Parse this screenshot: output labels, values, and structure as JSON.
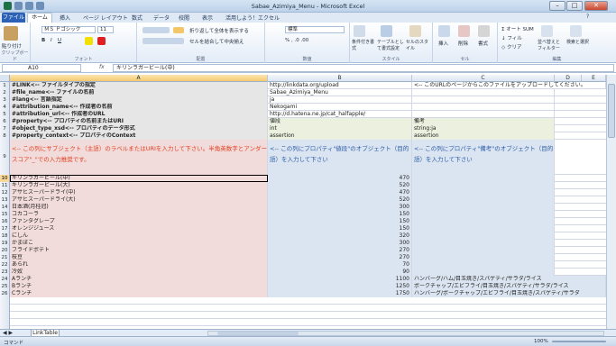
{
  "window": {
    "title": "Sabae_Azimiya_Menu - Microsoft Excel"
  },
  "ribbon_tabs": {
    "file": "ファイル",
    "home": "ホーム",
    "insert": "挿入",
    "page_layout": "ページ レイアウト",
    "formulas": "数式",
    "data": "データ",
    "review": "校閲",
    "view": "表示",
    "addins": "活用しよう！エクセル"
  },
  "ribbon": {
    "paste": "貼り付け",
    "clipboard": "クリップボード",
    "font_name": "ＭＳ Ｐゴシック",
    "font_size": "11",
    "font": "フォント",
    "wrap": "折り返して全体を表示する",
    "merge": "セルを結合して中央揃え",
    "alignment": "配置",
    "number_format": "標準",
    "number": "数値",
    "cond_format": "条件付き書式",
    "table_format": "テーブルとして書式設定",
    "cell_style": "セルのスタイル",
    "styles": "スタイル",
    "insert": "挿入",
    "delete": "削除",
    "format": "書式",
    "cells": "セル",
    "autosum": "オート SUM",
    "fill": "フィル",
    "clear": "クリア",
    "sort_filter": "並べ替えとフィルター",
    "find_select": "検索と選択",
    "editing": "編集"
  },
  "formula_bar": {
    "name_box": "A10",
    "fx": "fx",
    "formula": "キリンラガービール(中)"
  },
  "columns": {
    "a": "A",
    "b": "B",
    "c": "C",
    "d": "D",
    "e": "E"
  },
  "rows": [
    {
      "n": "1",
      "a": "#LINK<-- ファイルタイプの指定",
      "b": "http://linkdata.org/upload",
      "c": "<-- このURLのページからこのファイルをアップロードしてください。"
    },
    {
      "n": "2",
      "a": "#file_name<-- ファイルの名前",
      "b": "Sabae_Azimiya_Menu",
      "c": ""
    },
    {
      "n": "3",
      "a": "#lang<-- 言語指定",
      "b": "ja",
      "c": ""
    },
    {
      "n": "4",
      "a": "#attribution_name<-- 作成者の名前",
      "b": "Nekogami",
      "c": ""
    },
    {
      "n": "5",
      "a": "#attribution_url<-- 作成者のURL",
      "b": "http://d.hatena.ne.jp/cat_halfapple/",
      "c": ""
    },
    {
      "n": "6",
      "a": "#property<-- プロパティの名前またはURI",
      "b": "値段",
      "c": "備考"
    },
    {
      "n": "7",
      "a": "#object_type_xsd<-- プロパティのデータ形式",
      "b": "int",
      "c": "string:ja"
    },
    {
      "n": "8",
      "a": "#property_context<-- プロパティのContext",
      "b": "assertion",
      "c": "assertion"
    }
  ],
  "row9": {
    "n": "9",
    "a": "<-- この列にサブジェクト（主語）のラベルまたはURIを入力して下さい。半角英数字とアンダースコア\"_\"での入力推奨です。",
    "b": "<-- この列にプロパティ\"値段\"のオブジェクト（目的語）を入力して下さい",
    "c": "<-- この列にプロパティ\"備考\"のオブジェクト（目的語）を入力して下さい"
  },
  "data_rows": [
    {
      "n": "10",
      "a": "キリンラガービール(中)",
      "b": "470",
      "c": ""
    },
    {
      "n": "11",
      "a": "キリンラガービール(大)",
      "b": "520",
      "c": ""
    },
    {
      "n": "12",
      "a": "アサヒスーパードライ(中)",
      "b": "470",
      "c": ""
    },
    {
      "n": "13",
      "a": "アサヒスーパードライ(大)",
      "b": "520",
      "c": ""
    },
    {
      "n": "14",
      "a": "日本酒(月桂冠)",
      "b": "300",
      "c": ""
    },
    {
      "n": "15",
      "a": "コカコーラ",
      "b": "150",
      "c": ""
    },
    {
      "n": "16",
      "a": "ファンタグレープ",
      "b": "150",
      "c": ""
    },
    {
      "n": "17",
      "a": "オレンジジュース",
      "b": "150",
      "c": ""
    },
    {
      "n": "18",
      "a": "にしん",
      "b": "320",
      "c": ""
    },
    {
      "n": "19",
      "a": "かまぼこ",
      "b": "300",
      "c": ""
    },
    {
      "n": "20",
      "a": "フライドポテト",
      "b": "270",
      "c": ""
    },
    {
      "n": "21",
      "a": "枝豆",
      "b": "270",
      "c": ""
    },
    {
      "n": "22",
      "a": "あられ",
      "b": "70",
      "c": ""
    },
    {
      "n": "23",
      "a": "冷奴",
      "b": "90",
      "c": ""
    },
    {
      "n": "24",
      "a": "Aランチ",
      "b": "1100",
      "c": "ハンバーグ/ハム/目玉焼き/スパゲティ/サラダ/ライス"
    },
    {
      "n": "25",
      "a": "Bランチ",
      "b": "1250",
      "c": "ポークチャップ/エビフライ/目玉焼き/スパゲティ/サラダ/ライス"
    },
    {
      "n": "26",
      "a": "Cランチ",
      "b": "1750",
      "c": "ハンバーグ/ポークチャップ/エビフライ/目玉焼き/スパゲティ/サラダ"
    }
  ],
  "sheet": {
    "tab": "LinkTable"
  },
  "status": {
    "mode": "コマンド",
    "zoom": "100%"
  },
  "colors": {
    "accent": "#2b62b5",
    "row_header_fill": "#e6e6e6",
    "green_fill": "#ebf1de",
    "pink_fill": "#f2dcdb",
    "blue_fill": "#dbe5f1",
    "red_text": "#e04020",
    "blue_text": "#2a5ba8"
  }
}
